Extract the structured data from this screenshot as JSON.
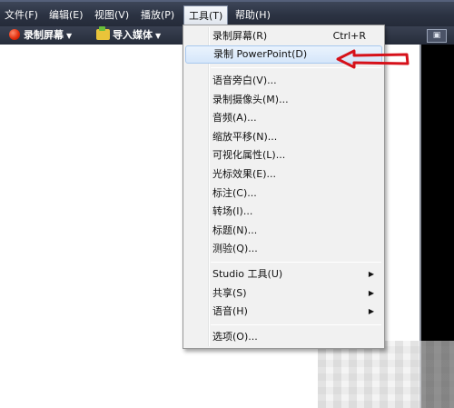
{
  "menubar": {
    "items": [
      {
        "label": "文件(F)"
      },
      {
        "label": "编辑(E)"
      },
      {
        "label": "视图(V)"
      },
      {
        "label": "播放(P)"
      },
      {
        "label": "工具(T)"
      },
      {
        "label": "帮助(H)"
      }
    ]
  },
  "toolbar": {
    "record_screen_label": "录制屏幕",
    "import_media_label": "导入媒体"
  },
  "tools_menu": {
    "items": [
      {
        "label": "录制屏幕(R)",
        "shortcut": "Ctrl+R"
      },
      {
        "label": "录制 PowerPoint(D)"
      },
      {
        "label": "语音旁白(V)..."
      },
      {
        "label": "录制摄像头(M)..."
      },
      {
        "label": "音频(A)..."
      },
      {
        "label": "缩放平移(N)..."
      },
      {
        "label": "可视化属性(L)..."
      },
      {
        "label": "光标效果(E)..."
      },
      {
        "label": "标注(C)..."
      },
      {
        "label": "转场(I)..."
      },
      {
        "label": "标题(N)..."
      },
      {
        "label": "测验(Q)..."
      },
      {
        "label": "Studio 工具(U)"
      },
      {
        "label": "共享(S)"
      },
      {
        "label": "语音(H)"
      },
      {
        "label": "选项(O)..."
      }
    ]
  },
  "colors": {
    "annotation_arrow": "#d6111a",
    "highlight": "#d5e6fa"
  }
}
